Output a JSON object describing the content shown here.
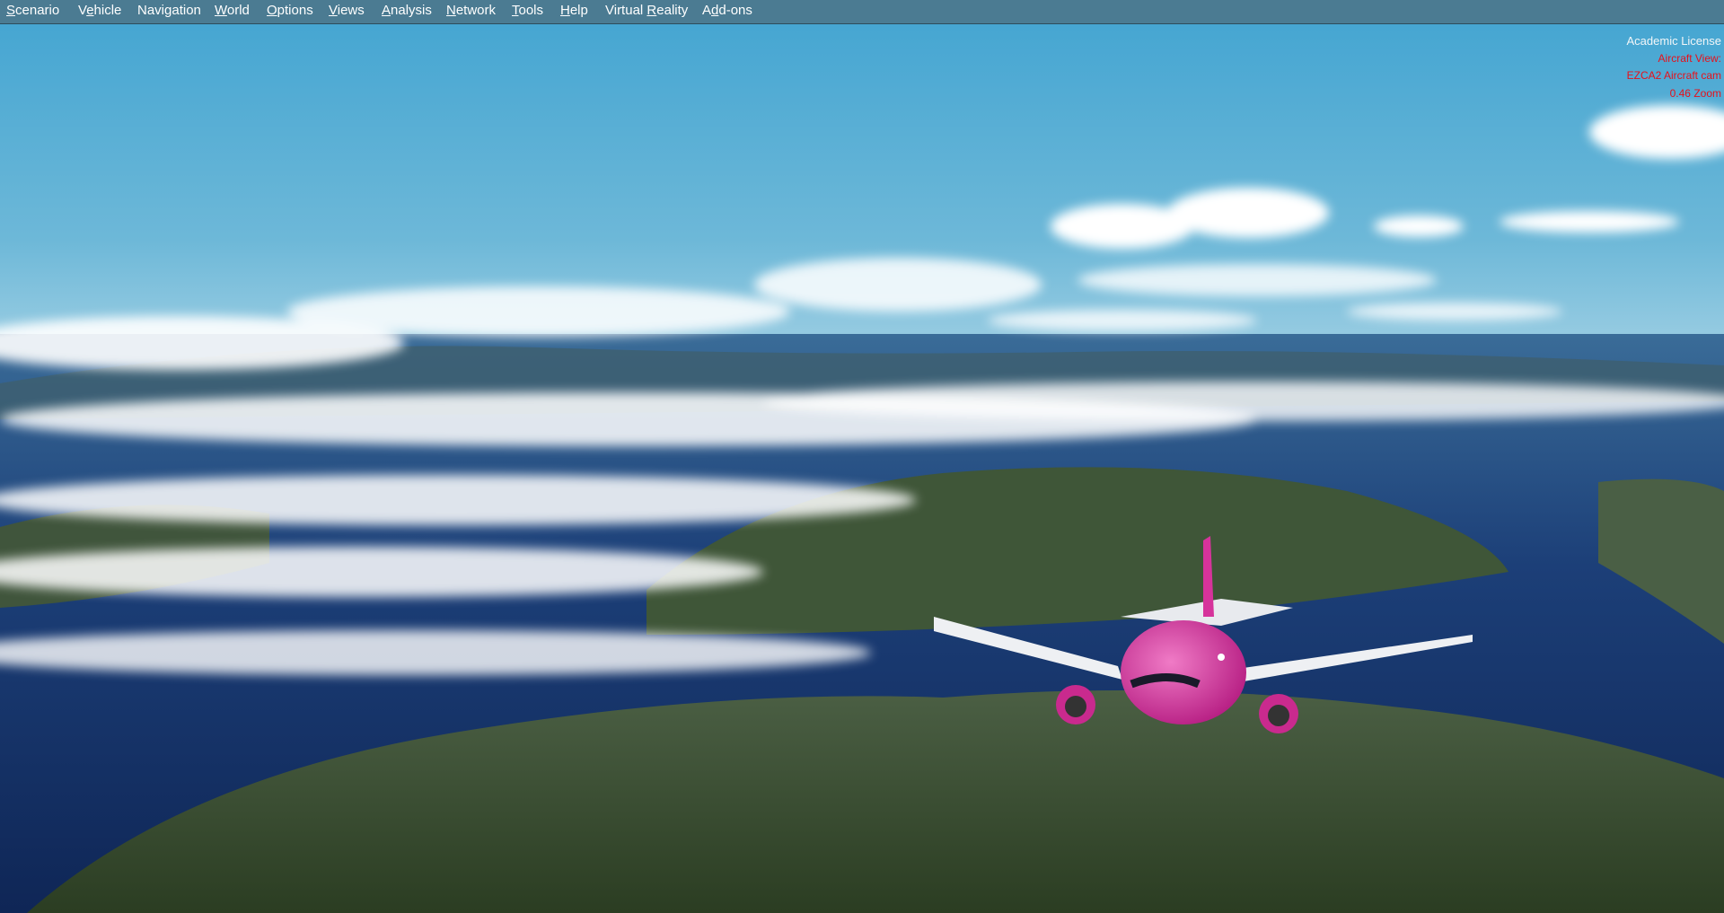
{
  "menu": [
    {
      "label": "Scenario",
      "accel": "S"
    },
    {
      "label": "Vehicle",
      "accel": "e"
    },
    {
      "label": "Navigation",
      "accel": ""
    },
    {
      "label": "World",
      "accel": "W"
    },
    {
      "label": "Options",
      "accel": "O"
    },
    {
      "label": "Views",
      "accel": "V"
    },
    {
      "label": "Analysis",
      "accel": "A"
    },
    {
      "label": "Network",
      "accel": "N"
    },
    {
      "label": "Tools",
      "accel": "T"
    },
    {
      "label": "Help",
      "accel": "H"
    },
    {
      "label": "Virtual Reality",
      "accel": "R"
    },
    {
      "label": "Add-ons",
      "accel": "d"
    }
  ],
  "overlay": {
    "license": "Academic License",
    "view_label": "Aircraft View:",
    "camera": "EZCA2 Aircraft cam",
    "zoom": "0.46 Zoom"
  },
  "colors": {
    "menubar": "#4b7b92",
    "overlay_red": "#e8101a",
    "aircraft": "#d6339b"
  }
}
